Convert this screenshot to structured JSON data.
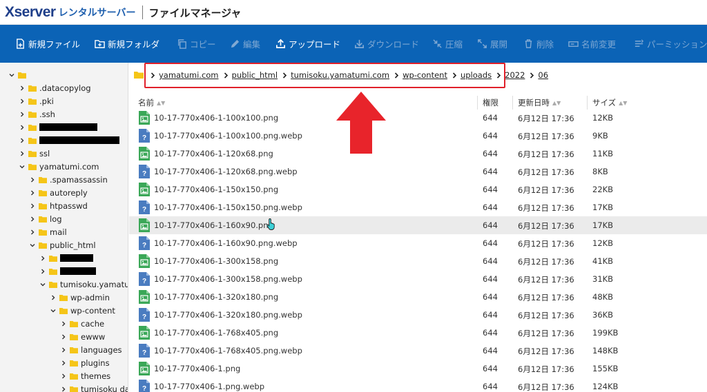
{
  "header": {
    "brand": "Xserver",
    "brand_sub": "レンタルサーバー",
    "app_title": "ファイルマネージャ"
  },
  "toolbar": {
    "items": [
      {
        "label": "新規ファイル",
        "icon": "new-file-icon",
        "enabled": true
      },
      {
        "label": "新規フォルダ",
        "icon": "new-folder-icon",
        "enabled": true
      },
      {
        "label": "コピー",
        "icon": "copy-icon",
        "enabled": false
      },
      {
        "label": "編集",
        "icon": "pencil-icon",
        "enabled": false
      },
      {
        "label": "アップロード",
        "icon": "upload-icon",
        "enabled": true
      },
      {
        "label": "ダウンロード",
        "icon": "download-icon",
        "enabled": false
      },
      {
        "label": "圧縮",
        "icon": "compress-icon",
        "enabled": false
      },
      {
        "label": "展開",
        "icon": "expand-icon",
        "enabled": false
      },
      {
        "label": "削除",
        "icon": "trash-icon",
        "enabled": false
      },
      {
        "label": "名前変更",
        "icon": "rename-icon",
        "enabled": false
      },
      {
        "label": "パーミッション変",
        "icon": "permission-icon",
        "enabled": false
      }
    ]
  },
  "tree": [
    {
      "label": "",
      "expanded": true,
      "redacted": false
    },
    {
      "label": ".datacopylog",
      "expanded": false,
      "redacted": false
    },
    {
      "label": ".pki",
      "expanded": false,
      "redacted": false
    },
    {
      "label": ".ssh",
      "expanded": false,
      "redacted": false
    },
    {
      "label": "",
      "expanded": false,
      "redacted": true
    },
    {
      "label": "",
      "expanded": false,
      "redacted": true
    },
    {
      "label": "ssl",
      "expanded": false,
      "redacted": false
    },
    {
      "label": "yamatumi.com",
      "expanded": true,
      "redacted": false
    },
    {
      "label": ".spamassassin",
      "expanded": false,
      "redacted": false
    },
    {
      "label": "autoreply",
      "expanded": false,
      "redacted": false
    },
    {
      "label": "htpasswd",
      "expanded": false,
      "redacted": false
    },
    {
      "label": "log",
      "expanded": false,
      "redacted": false
    },
    {
      "label": "mail",
      "expanded": false,
      "redacted": false
    },
    {
      "label": "public_html",
      "expanded": true,
      "redacted": false
    },
    {
      "label": "",
      "expanded": false,
      "redacted": true
    },
    {
      "label": "",
      "expanded": false,
      "redacted": true
    },
    {
      "label": "tumisoku.yamatumi.",
      "expanded": true,
      "redacted": false
    },
    {
      "label": "wp-admin",
      "expanded": false,
      "redacted": false
    },
    {
      "label": "wp-content",
      "expanded": true,
      "redacted": false
    },
    {
      "label": "cache",
      "expanded": false,
      "redacted": false
    },
    {
      "label": "ewww",
      "expanded": false,
      "redacted": false
    },
    {
      "label": "languages",
      "expanded": false,
      "redacted": false
    },
    {
      "label": "plugins",
      "expanded": false,
      "redacted": false
    },
    {
      "label": "themes",
      "expanded": false,
      "redacted": false
    },
    {
      "label": "tumisoku datal",
      "expanded": false,
      "redacted": false
    }
  ],
  "breadcrumb": [
    "yamatumi.com",
    "public_html",
    "tumisoku.yamatumi.com",
    "wp-content",
    "uploads",
    "2022",
    "06"
  ],
  "columns": {
    "name": "名前",
    "perm": "権限",
    "date": "更新日時",
    "size": "サイズ"
  },
  "files": [
    {
      "name": "10-17-770x406-1-100x100.png",
      "type": "png",
      "perm": "644",
      "date": "6月12日 17:36",
      "size": "12KB"
    },
    {
      "name": "10-17-770x406-1-100x100.png.webp",
      "type": "webp",
      "perm": "644",
      "date": "6月12日 17:36",
      "size": "9KB"
    },
    {
      "name": "10-17-770x406-1-120x68.png",
      "type": "png",
      "perm": "644",
      "date": "6月12日 17:36",
      "size": "11KB"
    },
    {
      "name": "10-17-770x406-1-120x68.png.webp",
      "type": "webp",
      "perm": "644",
      "date": "6月12日 17:36",
      "size": "8KB"
    },
    {
      "name": "10-17-770x406-1-150x150.png",
      "type": "png",
      "perm": "644",
      "date": "6月12日 17:36",
      "size": "22KB"
    },
    {
      "name": "10-17-770x406-1-150x150.png.webp",
      "type": "webp",
      "perm": "644",
      "date": "6月12日 17:36",
      "size": "17KB"
    },
    {
      "name": "10-17-770x406-1-160x90.png",
      "type": "png",
      "perm": "644",
      "date": "6月12日 17:36",
      "size": "17KB"
    },
    {
      "name": "10-17-770x406-1-160x90.png.webp",
      "type": "webp",
      "perm": "644",
      "date": "6月12日 17:36",
      "size": "12KB"
    },
    {
      "name": "10-17-770x406-1-300x158.png",
      "type": "png",
      "perm": "644",
      "date": "6月12日 17:36",
      "size": "41KB"
    },
    {
      "name": "10-17-770x406-1-300x158.png.webp",
      "type": "webp",
      "perm": "644",
      "date": "6月12日 17:36",
      "size": "31KB"
    },
    {
      "name": "10-17-770x406-1-320x180.png",
      "type": "png",
      "perm": "644",
      "date": "6月12日 17:36",
      "size": "48KB"
    },
    {
      "name": "10-17-770x406-1-320x180.png.webp",
      "type": "webp",
      "perm": "644",
      "date": "6月12日 17:36",
      "size": "36KB"
    },
    {
      "name": "10-17-770x406-1-768x405.png",
      "type": "png",
      "perm": "644",
      "date": "6月12日 17:36",
      "size": "199KB"
    },
    {
      "name": "10-17-770x406-1-768x405.png.webp",
      "type": "webp",
      "perm": "644",
      "date": "6月12日 17:36",
      "size": "148KB"
    },
    {
      "name": "10-17-770x406-1.png",
      "type": "png",
      "perm": "644",
      "date": "6月12日 17:36",
      "size": "155KB"
    },
    {
      "name": "10-17-770x406-1.png.webp",
      "type": "webp",
      "perm": "644",
      "date": "6月12日 17:36",
      "size": "124KB"
    }
  ],
  "hovered_row": 6,
  "colors": {
    "toolbar_bg": "#0b63b6",
    "highlight_red": "#e0202a",
    "png_icon": "#3aa757",
    "webp_icon": "#4a7cc0",
    "folder": "#f5c518"
  }
}
